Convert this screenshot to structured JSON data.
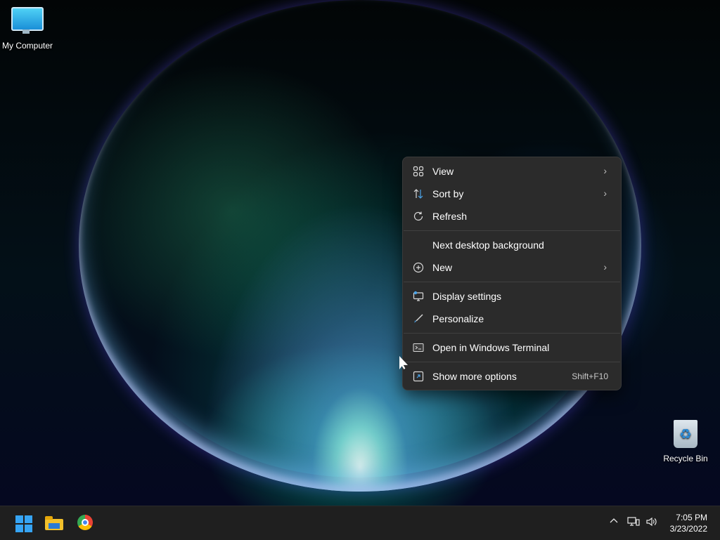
{
  "desktop": {
    "icons": [
      {
        "label": "My Computer"
      },
      {
        "label": "Recycle Bin"
      }
    ]
  },
  "context_menu": {
    "items": [
      {
        "label": "View",
        "icon": "grid-icon",
        "submenu": true
      },
      {
        "label": "Sort by",
        "icon": "sort-icon",
        "submenu": true
      },
      {
        "label": "Refresh",
        "icon": "refresh-icon",
        "submenu": false
      },
      {
        "label": "Next desktop background",
        "icon": "",
        "submenu": false
      },
      {
        "label": "New",
        "icon": "plus-circle-icon",
        "submenu": true
      },
      {
        "label": "Display settings",
        "icon": "display-icon",
        "submenu": false
      },
      {
        "label": "Personalize",
        "icon": "brush-icon",
        "submenu": false
      },
      {
        "label": "Open in Windows Terminal",
        "icon": "terminal-icon",
        "submenu": false
      },
      {
        "label": "Show more options",
        "icon": "expand-icon",
        "shortcut": "Shift+F10"
      }
    ]
  },
  "taskbar": {
    "apps": [
      {
        "name": "Start",
        "icon": "windows-logo-icon"
      },
      {
        "name": "File Explorer",
        "icon": "folder-icon"
      },
      {
        "name": "Google Chrome",
        "icon": "chrome-icon"
      }
    ],
    "tray": {
      "chevron": "^",
      "time": "7:05 PM",
      "date": "3/23/2022"
    }
  },
  "colors": {
    "menu_bg": "#2b2b2b",
    "taskbar_bg": "#1f1f1f",
    "accent": "#36a4f4"
  }
}
